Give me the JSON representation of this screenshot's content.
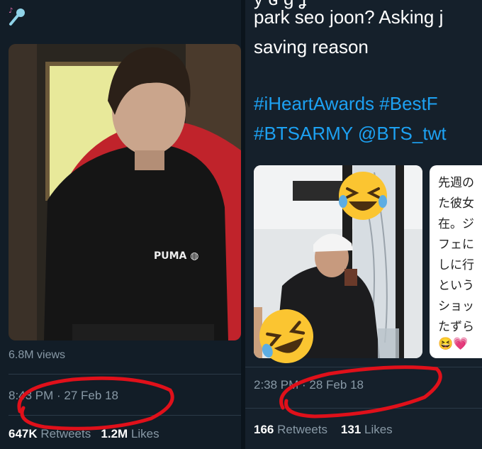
{
  "left": {
    "views": "6.8M views",
    "timestamp": "8:43 PM · 27 Feb 18",
    "retweets_count": "647K",
    "retweets_label": "Retweets",
    "likes_count": "1.2M",
    "likes_label": "Likes"
  },
  "right": {
    "tweet_line1": "park seo joon? Asking j",
    "tweet_line2": "saving reason",
    "hashtag1": "#iHeartAwards",
    "hashtag2": "#BestF",
    "hashtag3": "#BTSARMY",
    "mention": "@BTS_twt",
    "jp_lines": [
      "先週の",
      "た彼女",
      "在。ジ",
      "フェに",
      "しに行",
      "という",
      "ショッ",
      "たずら",
      "😆💗"
    ],
    "timestamp": "2:38 PM · 28 Feb 18",
    "retweets_count": "166",
    "retweets_label": "Retweets",
    "likes_count": "131",
    "likes_label": "Likes"
  },
  "colors": {
    "background": "#15202b",
    "link": "#1da1f2",
    "muted": "#8899a6",
    "annotation": "#e0101a"
  }
}
